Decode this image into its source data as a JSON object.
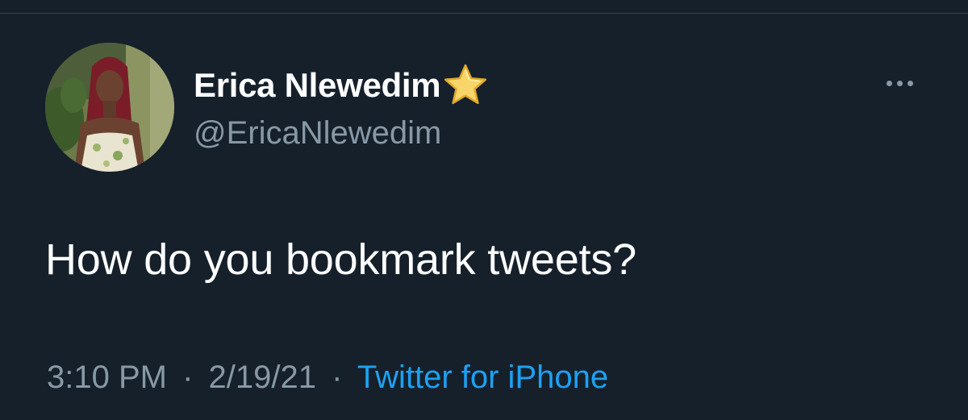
{
  "tweet": {
    "author": {
      "display_name": "Erica Nlewedim",
      "handle": "@EricaNlewedim",
      "badge_icon": "star-icon",
      "avatar_icon": "profile-photo"
    },
    "text": "How do you bookmark tweets?",
    "time": "3:10 PM",
    "date": "2/19/21",
    "separator": "·",
    "source": "Twitter for iPhone",
    "more_icon": "more-horizontal-icon"
  },
  "colors": {
    "background": "#15202b",
    "primary_text": "#ffffff",
    "secondary_text": "#8899a6",
    "link": "#1da1f2",
    "divider": "#38444d"
  }
}
